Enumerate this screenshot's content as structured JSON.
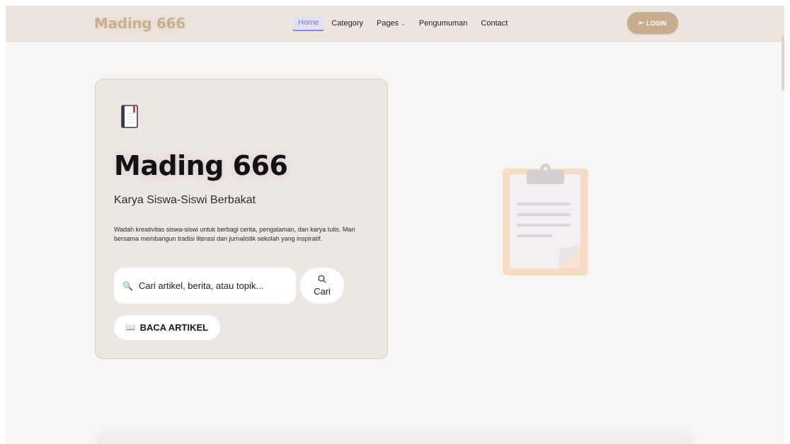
{
  "navbar": {
    "brand": "Mading 666",
    "items": [
      {
        "label": "Home"
      },
      {
        "label": "Category"
      },
      {
        "label": "Pages"
      },
      {
        "label": "Pengumuman"
      },
      {
        "label": "Contact"
      }
    ],
    "login_label": "LOGIN"
  },
  "hero": {
    "icon": "notebook-icon",
    "title": "Mading 666",
    "subtitle": "Karya Siswa-Siswi Berbakat",
    "description": "Wadah kreativitas siswa-siswi untuk berbagi cerita, pengalaman, dan karya tulis. Mari bersama membangun tradisi literasi dan jurnalistik sekolah yang inspiratif.",
    "search_placeholder": "Cari artikel, berita, atau topik...",
    "search_button": "Cari",
    "read_button": "BACA ARTIKEL"
  },
  "illustration": "clipboard-icon",
  "colors": {
    "navbar_bg": "#ede6df",
    "accent": "#c7ac8d",
    "active_nav": "#6f7fe0",
    "card_bg": "#ede7e1"
  }
}
